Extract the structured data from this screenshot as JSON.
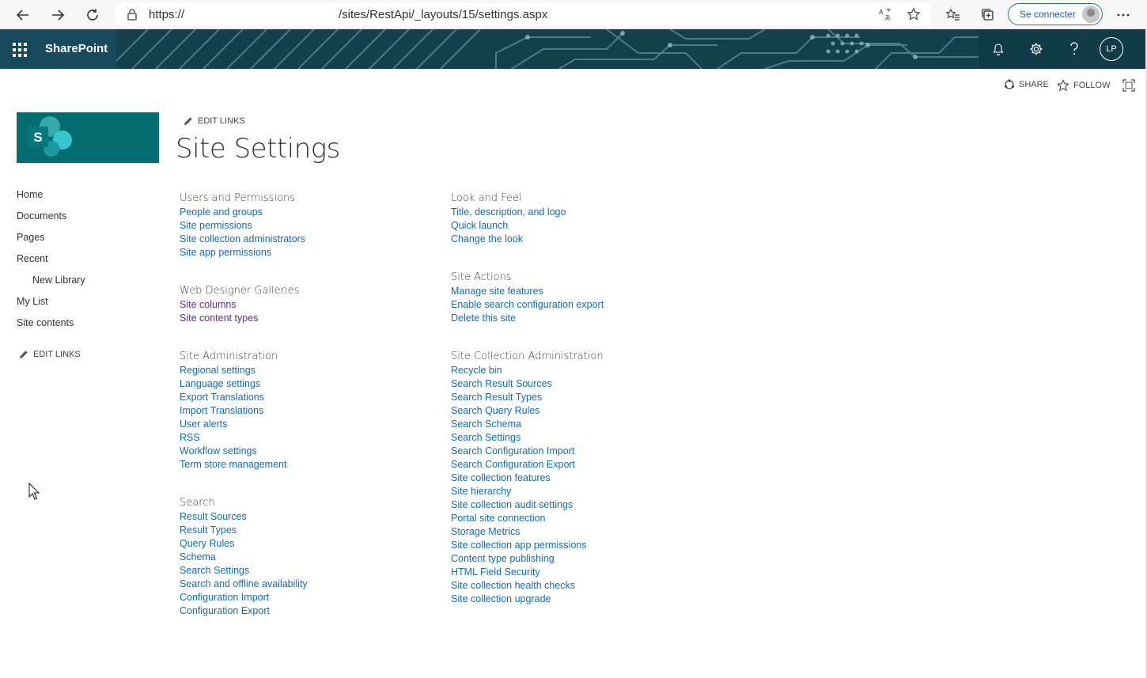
{
  "browser": {
    "url_scheme": "https://",
    "url_path": "/sites/RestApi/_layouts/15/settings.aspx",
    "signin_label": "Se connecter"
  },
  "suitebar": {
    "brand": "SharePoint",
    "user_initials": "LP",
    "background_color": "#0d2f3a"
  },
  "actions": {
    "share": "SHARE",
    "follow": "FOLLOW"
  },
  "page": {
    "edit_links": "EDIT LINKS",
    "title": "Site Settings",
    "logo_letter": "S"
  },
  "leftnav": {
    "items": [
      {
        "label": "Home"
      },
      {
        "label": "Documents"
      },
      {
        "label": "Pages"
      },
      {
        "label": "Recent"
      },
      {
        "label": "New Library"
      },
      {
        "label": "My List"
      },
      {
        "label": "Site contents"
      }
    ],
    "edit_links": "EDIT LINKS"
  },
  "groups": {
    "users": {
      "heading": "Users and Permissions",
      "links": [
        "People and groups",
        "Site permissions",
        "Site collection administrators",
        "Site app permissions"
      ]
    },
    "galleries": {
      "heading": "Web Designer Galleries",
      "links": [
        "Site columns",
        "Site content types"
      ]
    },
    "admin": {
      "heading": "Site Administration",
      "links": [
        "Regional settings",
        "Language settings",
        "Export Translations",
        "Import Translations",
        "User alerts",
        "RSS",
        "Workflow settings",
        "Term store management"
      ]
    },
    "search": {
      "heading": "Search",
      "links": [
        "Result Sources",
        "Result Types",
        "Query Rules",
        "Schema",
        "Search Settings",
        "Search and offline availability",
        "Configuration Import",
        "Configuration Export"
      ]
    },
    "look": {
      "heading": "Look and Feel",
      "links": [
        "Title, description, and logo",
        "Quick launch",
        "Change the look"
      ]
    },
    "actions": {
      "heading": "Site Actions",
      "links": [
        "Manage site features",
        "Enable search configuration export",
        "Delete this site"
      ]
    },
    "collection": {
      "heading": "Site Collection Administration",
      "links": [
        "Recycle bin",
        "Search Result Sources",
        "Search Result Types",
        "Search Query Rules",
        "Search Schema",
        "Search Settings",
        "Search Configuration Import",
        "Search Configuration Export",
        "Site collection features",
        "Site hierarchy",
        "Site collection audit settings",
        "Portal site connection",
        "Storage Metrics",
        "Site collection app permissions",
        "Content type publishing",
        "HTML Field Security",
        "Site collection health checks",
        "Site collection upgrade"
      ]
    }
  },
  "colors": {
    "link": "#0f6cbd",
    "visited_link": "#5c2d91",
    "logo_bg": "#036c70"
  }
}
